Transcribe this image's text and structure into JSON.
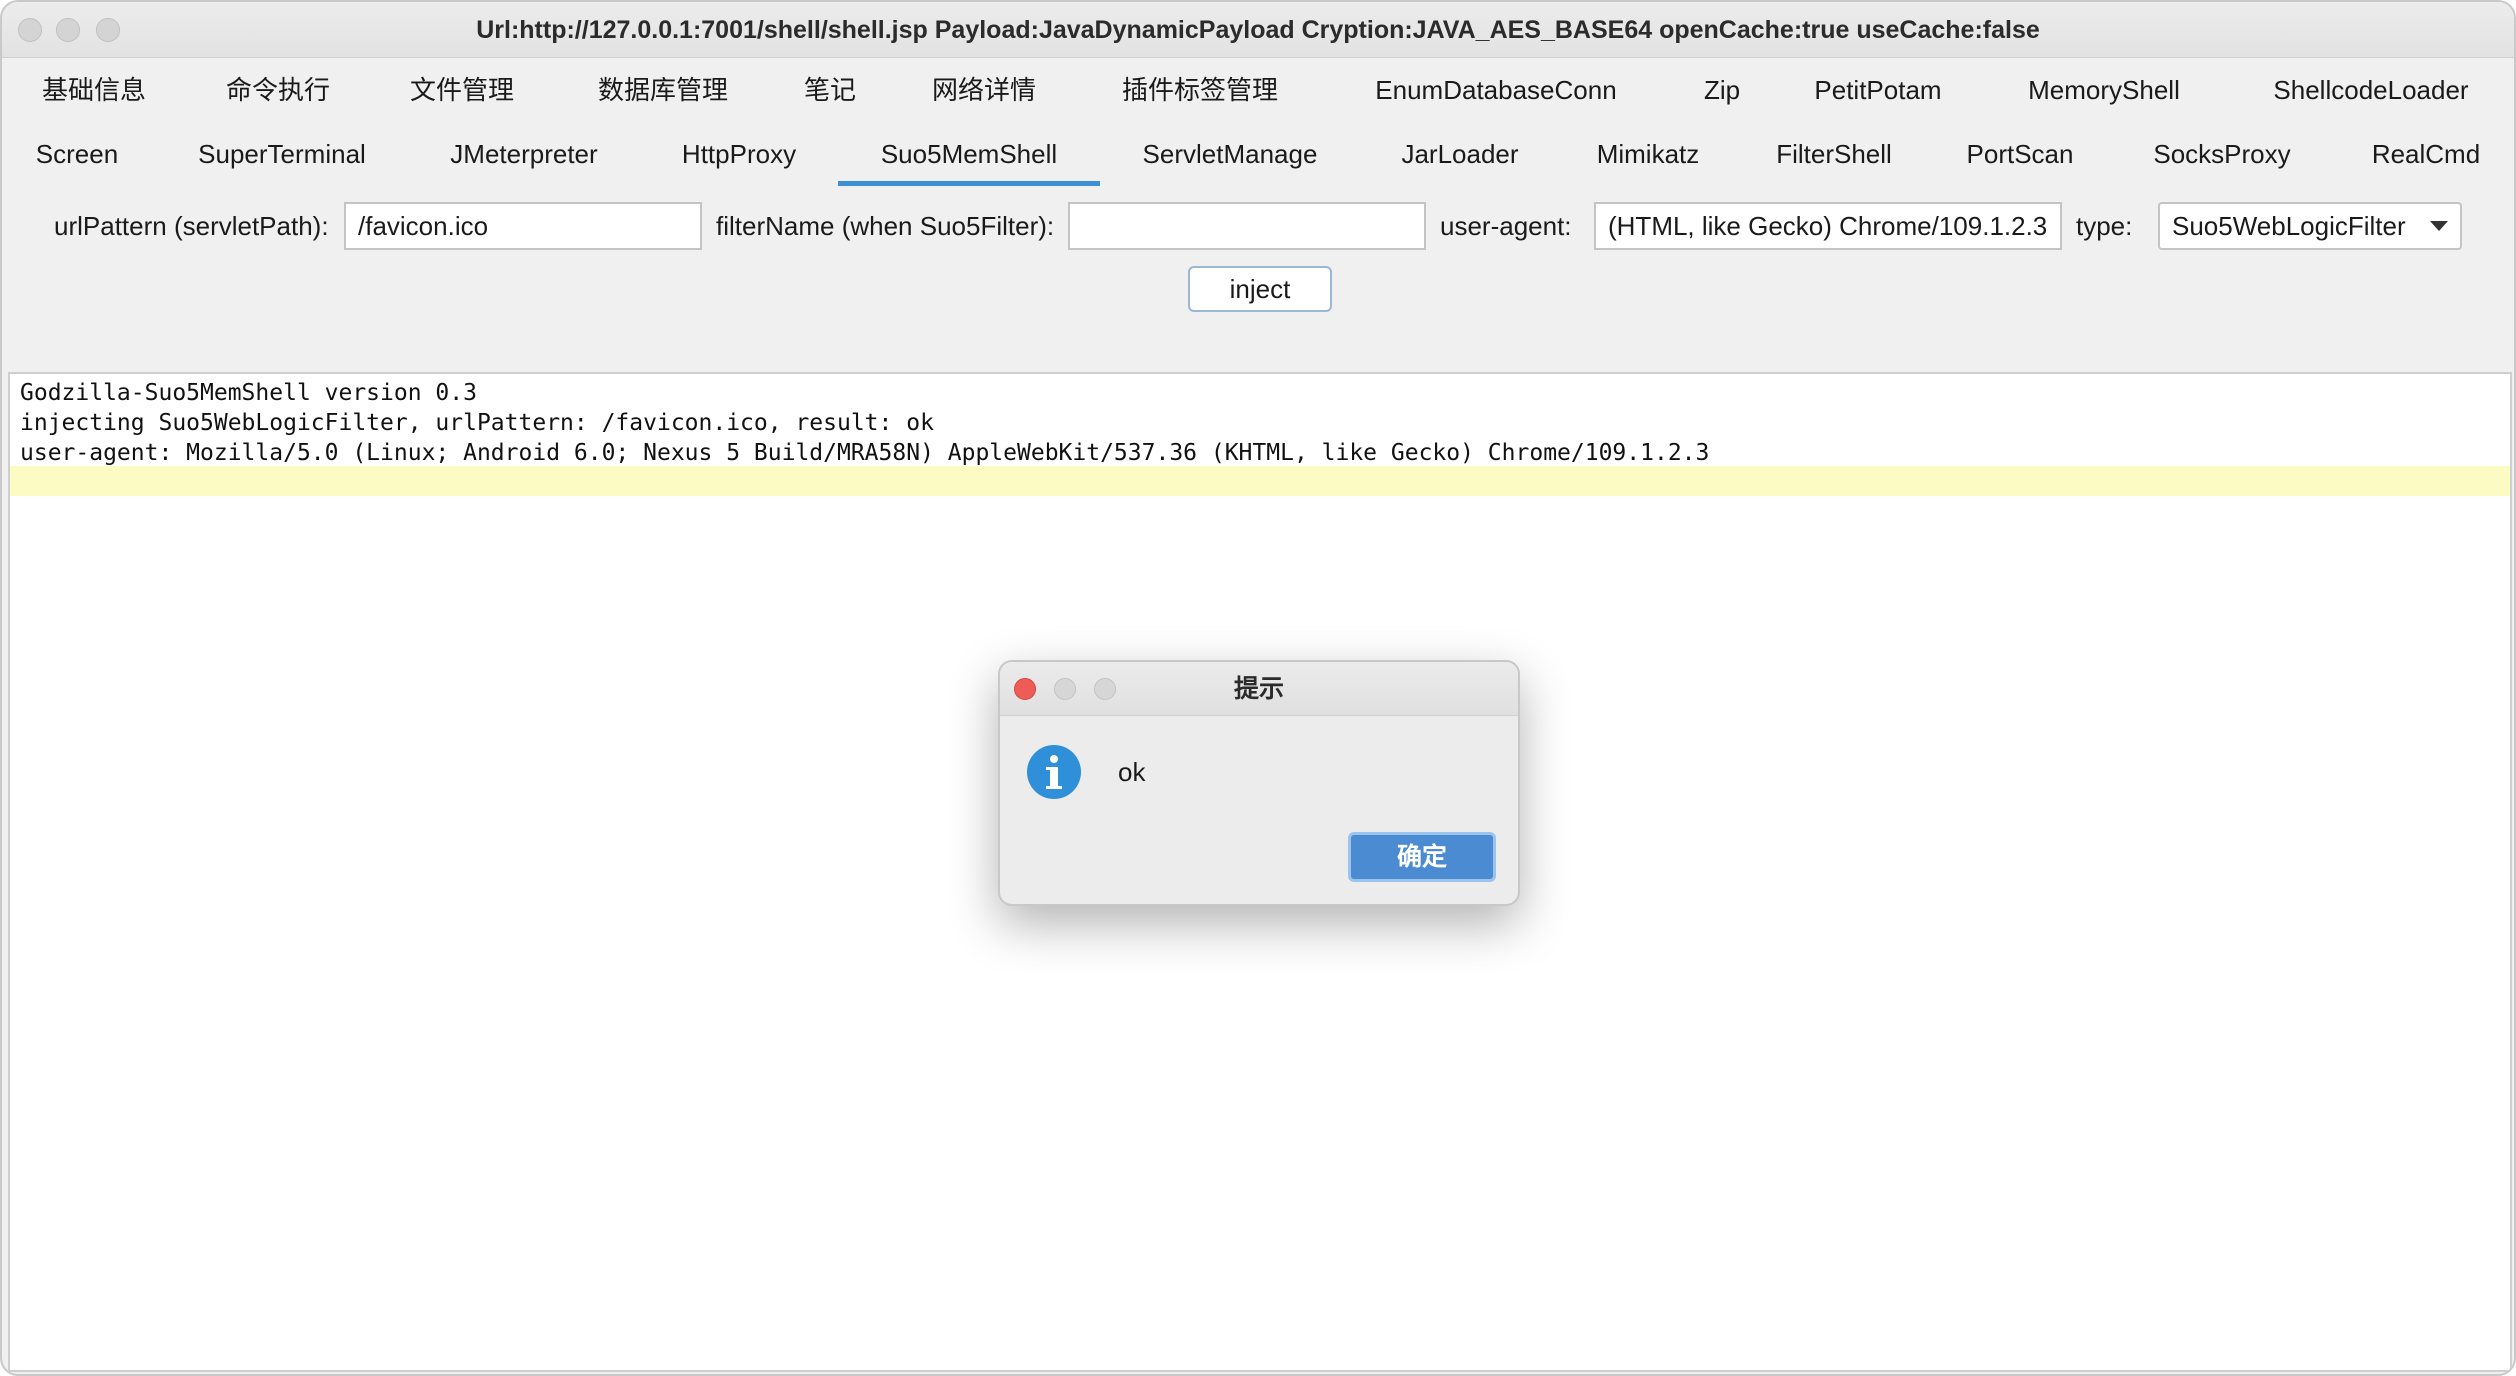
{
  "window": {
    "title": "Url:http://127.0.0.1:7001/shell/shell.jsp Payload:JavaDynamicPayload Cryption:JAVA_AES_BASE64 openCache:true useCache:false"
  },
  "tabs_row1": [
    "基础信息",
    "命令执行",
    "文件管理",
    "数据库管理",
    "笔记",
    "网络详情",
    "插件标签管理",
    "EnumDatabaseConn",
    "Zip",
    "PetitPotam",
    "MemoryShell",
    "ShellcodeLoader"
  ],
  "tabs_row2": [
    "Screen",
    "SuperTerminal",
    "JMeterpreter",
    "HttpProxy",
    "Suo5MemShell",
    "ServletManage",
    "JarLoader",
    "Mimikatz",
    "FilterShell",
    "PortScan",
    "SocksProxy",
    "RealCmd"
  ],
  "selected_tab": "Suo5MemShell",
  "form": {
    "url_pattern_label": "urlPattern (servletPath):",
    "url_pattern_value": "/favicon.ico",
    "filter_name_label": "filterName (when Suo5Filter):",
    "filter_name_value": "",
    "user_agent_label": "user-agent:",
    "user_agent_value": "(HTML, like Gecko) Chrome/109.1.2.3",
    "type_label": "type:",
    "type_value": "Suo5WebLogicFilter",
    "inject_label": "inject"
  },
  "output": {
    "lines": [
      "Godzilla-Suo5MemShell version 0.3",
      "injecting Suo5WebLogicFilter, urlPattern: /favicon.ico, result: ok",
      "user-agent: Mozilla/5.0 (Linux; Android 6.0; Nexus 5 Build/MRA58N) AppleWebKit/537.36 (KHTML, like Gecko) Chrome/109.1.2.3"
    ]
  },
  "dialog": {
    "title": "提示",
    "icon": "info-icon",
    "message": "ok",
    "ok_label": "确定"
  },
  "colors": {
    "accent": "#3d8fd6",
    "ok_button": "#4a8bd2",
    "current_line": "#fdfbc4",
    "close_button": "#ee5d55"
  }
}
